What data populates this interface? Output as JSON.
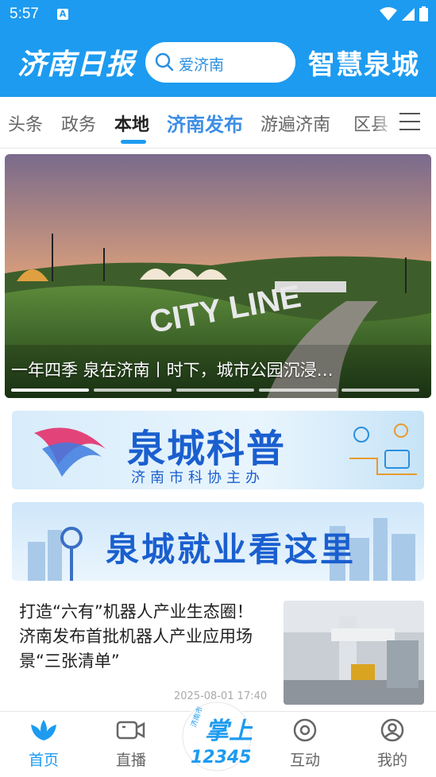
{
  "status_bar": {
    "time": "5:57",
    "notification_icon": "A"
  },
  "header": {
    "logo_left": "济南日报",
    "search_placeholder": "爱济南",
    "logo_right": "智慧泉城"
  },
  "tabs": [
    "头条",
    "政务",
    "本地",
    "济南发布",
    "游遍济南",
    "区县"
  ],
  "active_tab": "本地",
  "banner": {
    "sign_text": "CITY LINE",
    "caption": "一年四季 泉在济南丨时下，城市公园沉浸…",
    "slide_count": 5
  },
  "ads": [
    {
      "title": "泉城科普",
      "subtitle": "济南市科协主办"
    },
    {
      "title": "泉城就业看这里"
    }
  ],
  "article": {
    "title": "打造“六有”机器人产业生态圈！济南发布首批机器人产业应用场景“三张清单”",
    "time": "2025-08-01 17:40"
  },
  "bottom_nav": [
    {
      "label": "首页",
      "icon": "lotus-icon",
      "active": true
    },
    {
      "label": "直播",
      "icon": "video-camera-icon",
      "active": false
    },
    {
      "label": "",
      "icon": "palm-12345-icon",
      "active": false
    },
    {
      "label": "互动",
      "icon": "chat-bubble-icon",
      "active": false
    },
    {
      "label": "我的",
      "icon": "user-icon",
      "active": false
    }
  ],
  "center_badge": {
    "small_text": "济南市",
    "main_text": "掌上",
    "number": "12345"
  },
  "colors": {
    "brand": "#1d9bf0",
    "tab_highlight": "#3d8ee4",
    "ad_blue": "#1a5fcf"
  }
}
